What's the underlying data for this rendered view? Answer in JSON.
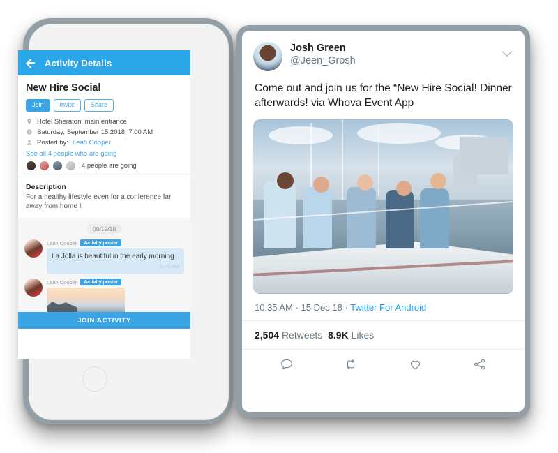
{
  "phone": {
    "appbar": {
      "title": "Activity Details",
      "back_icon": "back-arrow-icon"
    },
    "activity": {
      "title": "New Hire Social",
      "buttons": [
        {
          "label": "Join",
          "style": "primary"
        },
        {
          "label": "Invite",
          "style": "outline"
        },
        {
          "label": "Share",
          "style": "outline"
        }
      ],
      "location": "Hotel Sheraton, main entrance",
      "datetime": "Saturday, September 15 2018, 7:00 AM",
      "posted_by_prefix": "Posted by:",
      "posted_by_name": "Leah Cooper",
      "see_all_link": "See all 4 people who are going",
      "going_count_text": "4 people are going"
    },
    "description": {
      "heading": "Description",
      "body": "For a healthy lifestyle even for a conference far away from home !"
    },
    "chat": {
      "date_pill": "09/19/18",
      "messages": [
        {
          "author": "Leah Cooper",
          "badge": "Activity poster",
          "text": "La Jolla is beautiful in the early morning",
          "time": "11:40 AM",
          "type": "text"
        },
        {
          "author": "Leah Cooper",
          "badge": "Activity poster",
          "type": "image"
        }
      ]
    },
    "join_button": "JOIN ACTIVITY"
  },
  "tweet": {
    "display_name": "Josh Green",
    "handle": "@Jeen_Grosh",
    "chevron_icon": "chevron-down-icon",
    "text": "Come out and join us for the “New Hire Social! Dinner afterwards! via Whova Event App",
    "time": "10:35 AM",
    "date": "15 Dec 18",
    "source": "Twitter For Android",
    "sep": "·",
    "retweets_count": "2,504",
    "retweets_label": "Retweets",
    "likes_count": "8.9K",
    "likes_label": "Likes",
    "actions": [
      {
        "name": "reply-icon"
      },
      {
        "name": "retweet-icon"
      },
      {
        "name": "like-icon"
      },
      {
        "name": "share-icon"
      }
    ]
  },
  "colors": {
    "brand_blue": "#3ba4e5",
    "appbar_blue": "#2ba6e8",
    "twitter_blue": "#1da1f2",
    "bezel_gray": "#939fa6",
    "bubble_blue": "#d6e9f7"
  }
}
